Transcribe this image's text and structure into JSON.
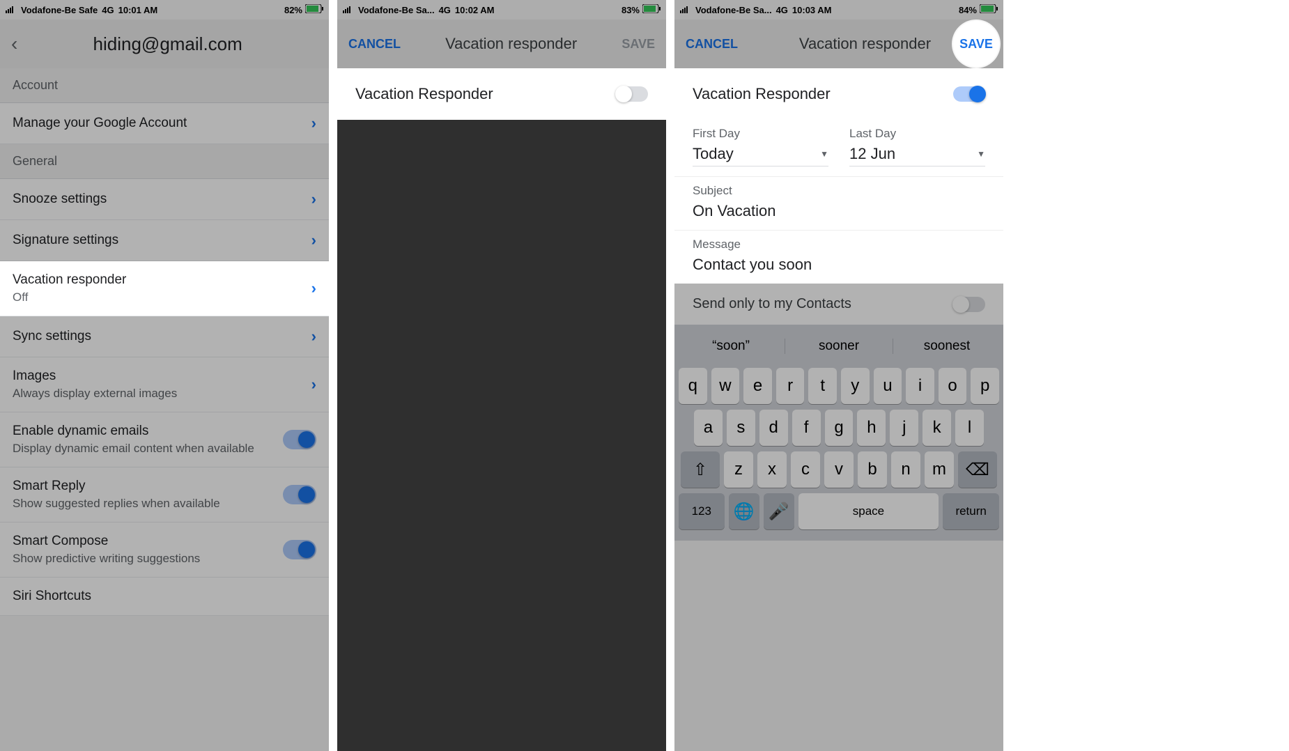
{
  "s1": {
    "status": {
      "carrier": "Vodafone-Be Safe",
      "net": "4G",
      "time": "10:01 AM",
      "battery": "82%"
    },
    "title": "hiding@gmail.com",
    "account_header": "Account",
    "manage": "Manage your Google Account",
    "general_header": "General",
    "snooze": "Snooze settings",
    "signature": "Signature settings",
    "vacation_label": "Vacation responder",
    "vacation_value": "Off",
    "sync": "Sync settings",
    "images_label": "Images",
    "images_sub": "Always display external images",
    "dyn_label": "Enable dynamic emails",
    "dyn_sub": "Display dynamic email content when available",
    "smartreply_label": "Smart Reply",
    "smartreply_sub": "Show suggested replies when available",
    "smartcompose_label": "Smart Compose",
    "smartcompose_sub": "Show predictive writing suggestions",
    "siri": "Siri Shortcuts"
  },
  "s2": {
    "status": {
      "carrier": "Vodafone-Be Sa...",
      "net": "4G",
      "time": "10:02 AM",
      "battery": "83%"
    },
    "cancel": "CANCEL",
    "title": "Vacation responder",
    "save": "SAVE",
    "toggle_label": "Vacation Responder"
  },
  "s3": {
    "status": {
      "carrier": "Vodafone-Be Sa...",
      "net": "4G",
      "time": "10:03 AM",
      "battery": "84%"
    },
    "cancel": "CANCEL",
    "title": "Vacation responder",
    "save": "SAVE",
    "toggle_label": "Vacation Responder",
    "first_day_label": "First Day",
    "first_day_value": "Today",
    "last_day_label": "Last Day",
    "last_day_value": "12 Jun",
    "subject_label": "Subject",
    "subject_value": "On Vacation",
    "message_label": "Message",
    "message_value": "Contact you soon",
    "contacts_label": "Send only to my Contacts",
    "suggestions": [
      "“soon”",
      "sooner",
      "soonest"
    ],
    "keys_r1": [
      "q",
      "w",
      "e",
      "r",
      "t",
      "y",
      "u",
      "i",
      "o",
      "p"
    ],
    "keys_r2": [
      "a",
      "s",
      "d",
      "f",
      "g",
      "h",
      "j",
      "k",
      "l"
    ],
    "keys_r3": [
      "z",
      "x",
      "c",
      "v",
      "b",
      "n",
      "m"
    ],
    "key_num": "123",
    "key_space": "space",
    "key_return": "return"
  }
}
